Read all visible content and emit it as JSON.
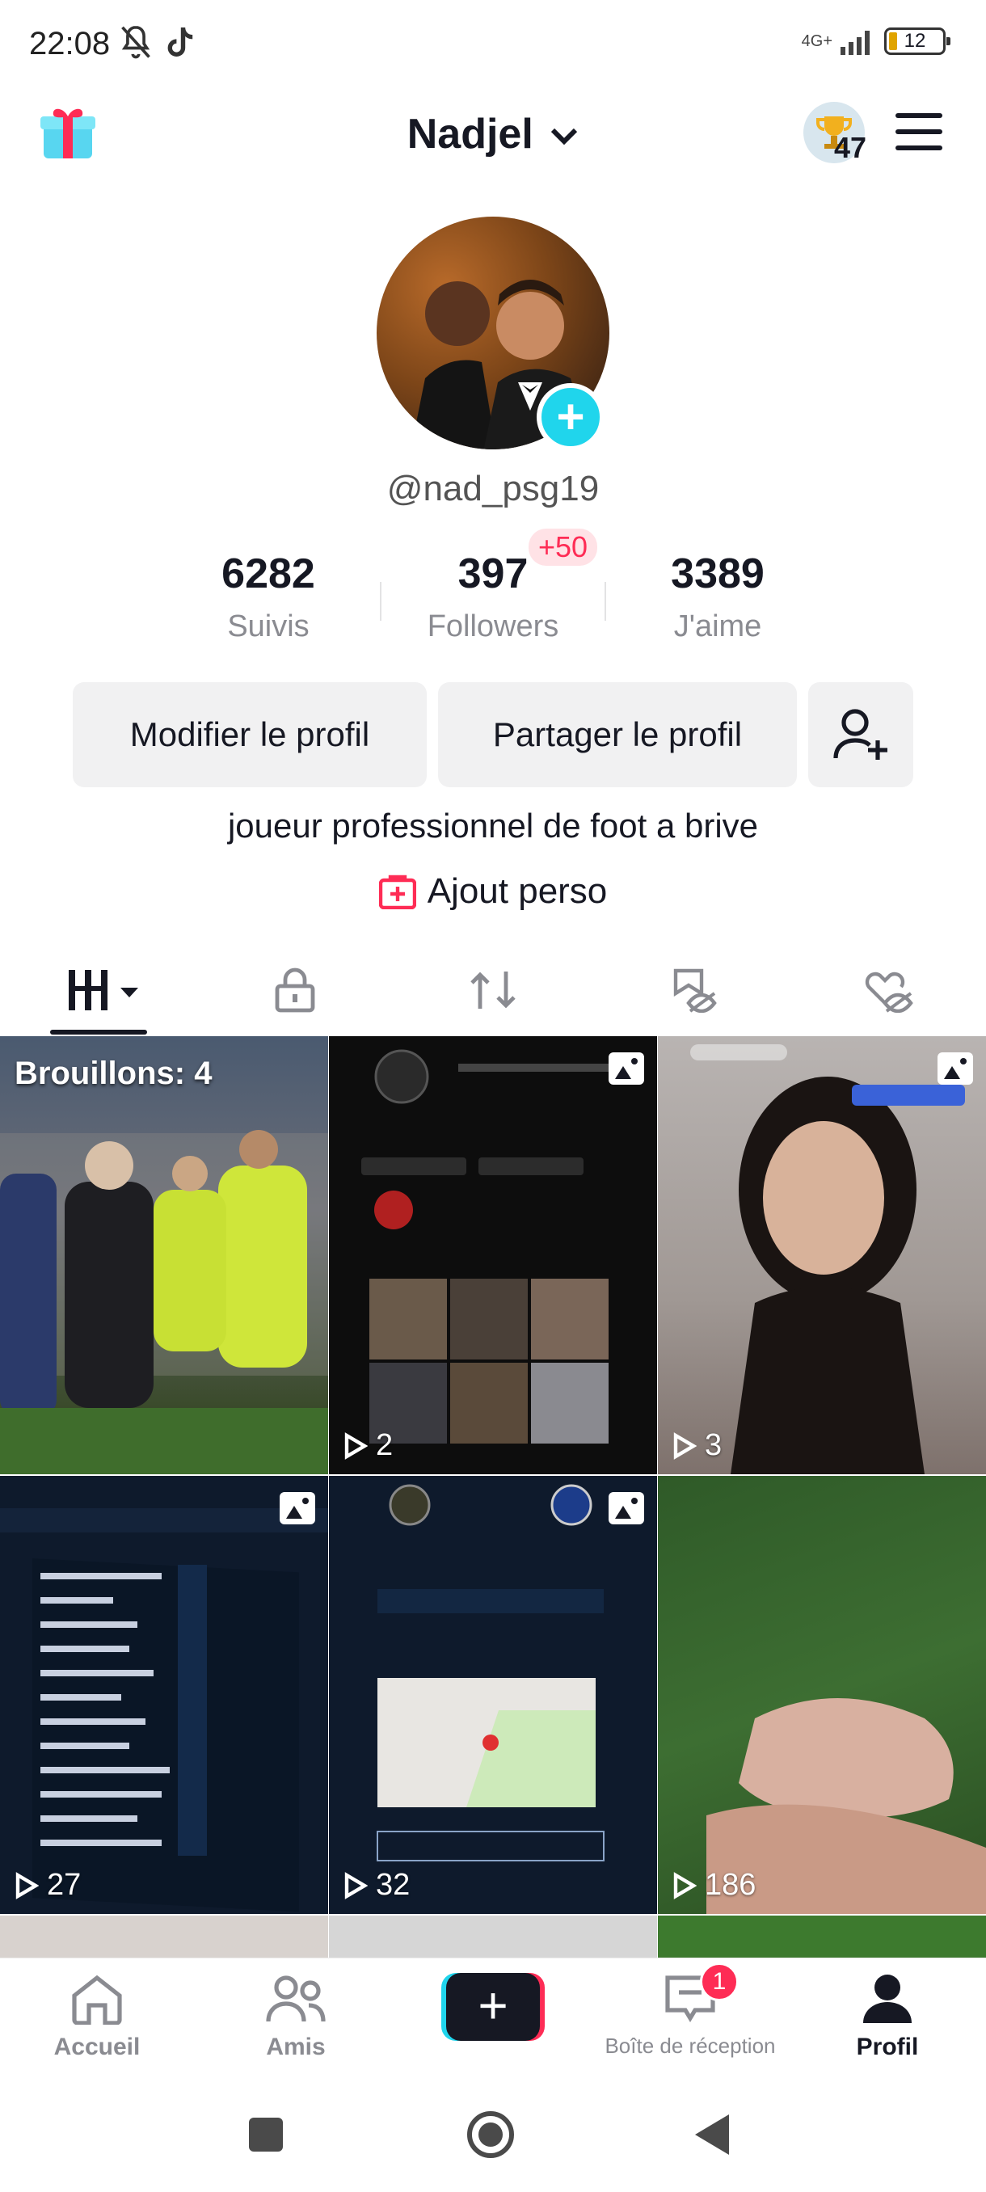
{
  "status_bar": {
    "time": "22:08",
    "network": "4G+",
    "battery": "12"
  },
  "header": {
    "username": "Nadjel",
    "trophy_count": "47"
  },
  "profile": {
    "handle": "@nad_psg19",
    "stats": [
      {
        "value": "6282",
        "label": "Suivis"
      },
      {
        "value": "397",
        "label": "Followers"
      },
      {
        "value": "3389",
        "label": "J'aime"
      }
    ],
    "followers_delta": "+50",
    "edit_button": "Modifier le profil",
    "share_button": "Partager le profil",
    "bio": "joueur professionnel de foot a brive",
    "link_label": "Ajout perso"
  },
  "grid": {
    "drafts_label": "Brouillons: 4",
    "cells": [
      {
        "views": ""
      },
      {
        "views": "2"
      },
      {
        "views": "3"
      },
      {
        "views": "27"
      },
      {
        "views": "32"
      },
      {
        "views": "186"
      }
    ]
  },
  "bottom_nav": {
    "home": "Accueil",
    "friends": "Amis",
    "inbox": "Boîte de réception",
    "inbox_badge": "1",
    "profile": "Profil"
  },
  "colors": {
    "accent": "#fe2c55",
    "cyan": "#20d5ec",
    "text": "#161823",
    "muted": "#8a8b91"
  }
}
